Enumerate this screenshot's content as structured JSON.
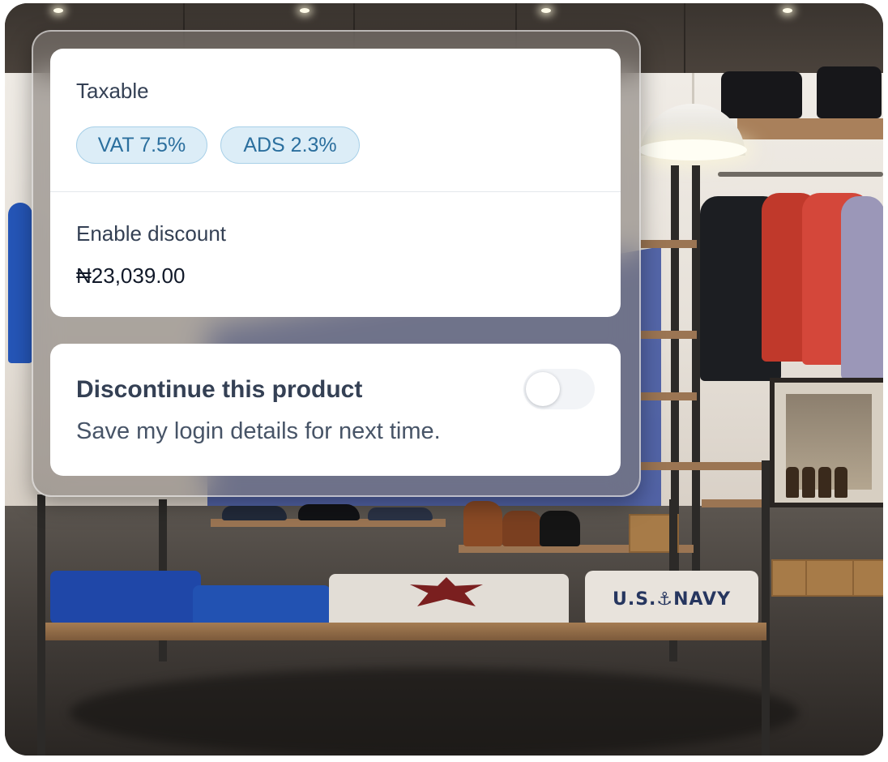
{
  "tax": {
    "label": "Taxable",
    "chips": [
      "VAT 7.5%",
      "ADS 2.3%"
    ]
  },
  "discount": {
    "label": "Enable discount",
    "amount": "₦23,039.00"
  },
  "discontinue": {
    "title": "Discontinue this product",
    "subtitle": "Save my login details for next time.",
    "toggle_on": false
  },
  "background": {
    "shirt_text": "U.S.⚓NAVY"
  },
  "colors": {
    "chip_bg": "#dcedf7",
    "chip_text": "#2b6f9e",
    "toggle_off": "#f2f4f7"
  }
}
